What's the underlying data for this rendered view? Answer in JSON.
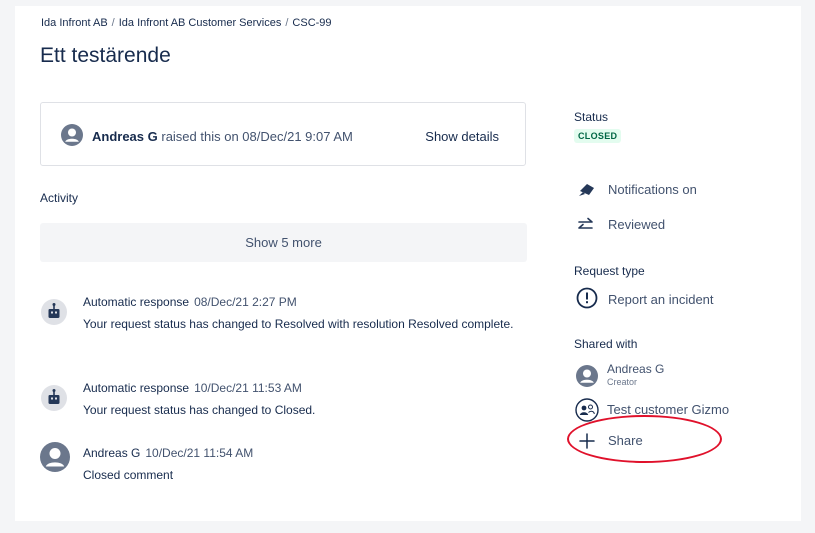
{
  "breadcrumb": [
    "Ida Infront AB",
    "Ida Infront AB Customer Services",
    "CSC-99"
  ],
  "breadcrumb_sep": "/",
  "title": "Ett testärende",
  "raised": {
    "name": "Andreas G",
    "text": " raised this on 08/Dec/21 9:07 AM",
    "details_label": "Show details"
  },
  "activity": {
    "heading": "Activity",
    "show_more": "Show 5 more",
    "items": [
      {
        "who": "Automatic response",
        "when": "08/Dec/21 2:27 PM",
        "body": "Your request status has changed to Resolved with resolution Resolved complete.",
        "icon": "robot-icon"
      },
      {
        "who": "Automatic response",
        "when": "10/Dec/21 11:53 AM",
        "body": "Your request status has changed to Closed.",
        "icon": "robot-icon"
      },
      {
        "who": "Andreas G",
        "when": "10/Dec/21 11:54 AM",
        "body": "Closed comment",
        "icon": "user-avatar-icon"
      }
    ]
  },
  "sidebar": {
    "status_label": "Status",
    "status_value": "CLOSED",
    "notifications": "Notifications on",
    "reviewed": "Reviewed",
    "request_type_label": "Request type",
    "request_type": "Report an incident",
    "shared_with_label": "Shared with",
    "shared": [
      {
        "name": "Andreas G",
        "role": "Creator"
      },
      {
        "name": "Test customer Gizmo",
        "role": ""
      }
    ],
    "share_label": "Share"
  },
  "colors": {
    "status_bg": "#e3fcef",
    "status_fg": "#006644",
    "annotation": "#e0112b"
  }
}
